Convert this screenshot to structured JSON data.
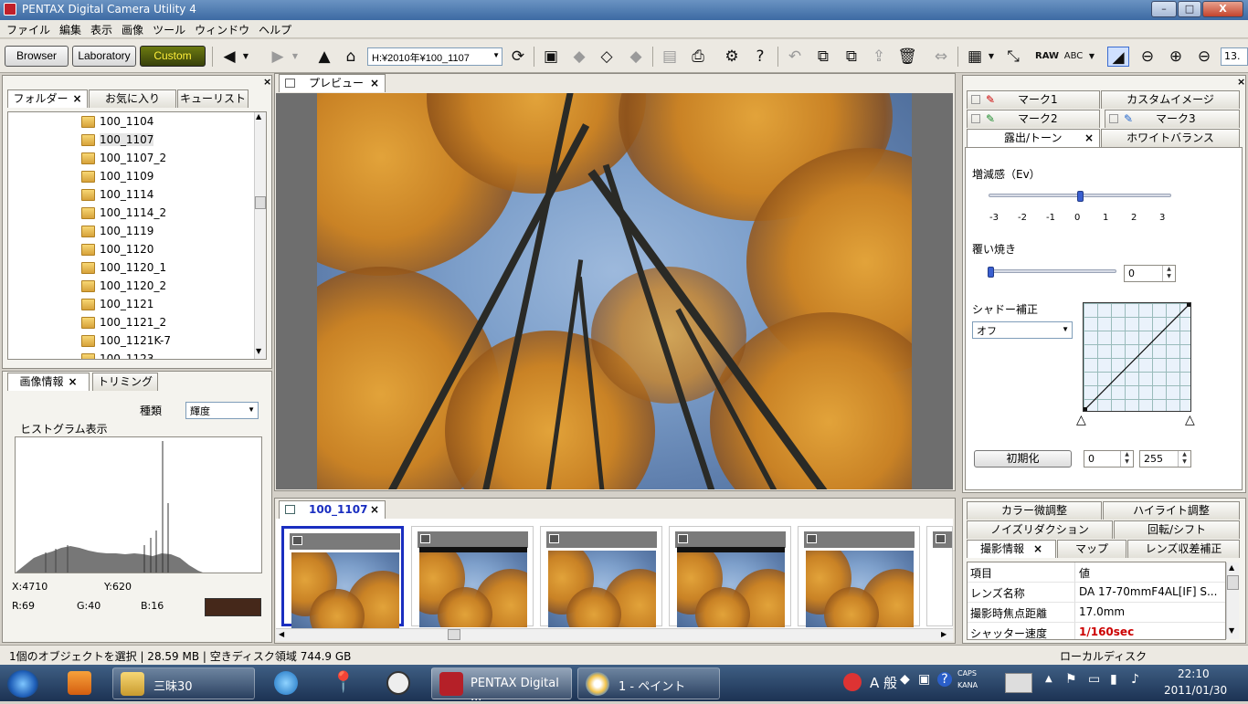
{
  "window": {
    "title": "PENTAX Digital Camera Utility 4",
    "min": "–",
    "max": "□",
    "close": "X"
  },
  "menu": [
    "ファイル",
    "編集",
    "表示",
    "画像",
    "ツール",
    "ウィンドウ",
    "ヘルプ"
  ],
  "toolbar": {
    "browser": "Browser",
    "laboratory": "Laboratory",
    "custom": "Custom",
    "path": "H:¥2010年¥100_1107",
    "zoom": "13."
  },
  "left": {
    "tabs": {
      "folder": "フォルダー",
      "favorites": "お気に入り",
      "curelist": "キューリスト"
    },
    "folders": [
      "100_1104",
      "100_1107",
      "100_1107_2",
      "100_1109",
      "100_1114",
      "100_1114_2",
      "100_1119",
      "100_1120",
      "100_1120_1",
      "100_1120_2",
      "100_1121",
      "100_1121_2",
      "100_1121K-7",
      "100_1123"
    ],
    "selected_folder": "100_1107",
    "info_tabs": {
      "image_info": "画像情報",
      "trimming": "トリミング"
    },
    "kind_label": "種類",
    "kind_value": "輝度",
    "histogram_label": "ヒストグラム表示",
    "x": "X:4710",
    "y": "Y:620",
    "r": "R:69",
    "g": "G:40",
    "b": "B:16",
    "swatch": "#45281a"
  },
  "preview": {
    "tab": "プレビュー",
    "close": "×"
  },
  "thumbs": {
    "tab": "100_1107",
    "close": "×"
  },
  "right": {
    "tabs": {
      "mark1": "マーク1",
      "custom_image": "カスタムイメージ",
      "mark2": "マーク2",
      "mark3": "マーク3",
      "exposure": "露出/トーン",
      "wb": "ホワイトバランス"
    },
    "ev_label": "増減感（Ev）",
    "ev_ticks": [
      "-3",
      "-2",
      "-1",
      "0",
      "1",
      "2",
      "3"
    ],
    "burn_label": "覆い焼き",
    "burn_value": "0",
    "shadow_label": "シャドー補正",
    "shadow_value": "オフ",
    "reset": "初期化",
    "lo": "0",
    "hi": "255",
    "bottom_tabs": {
      "color": "カラー微調整",
      "highlight": "ハイライト調整",
      "noise": "ノイズリダクション",
      "rotate": "回転/シフト",
      "shooting": "撮影情報",
      "map": "マップ",
      "lens": "レンズ収差補正"
    },
    "table_header": {
      "item": "項目",
      "value": "値"
    },
    "table_rows": [
      {
        "item": "レンズ名称",
        "value": "DA 17-70mmF4AL[IF] S..."
      },
      {
        "item": "撮影時焦点距離",
        "value": "17.0mm"
      },
      {
        "item": "シャッター速度",
        "value": "1/160sec"
      }
    ],
    "shutter_color": "#cc0000"
  },
  "status": {
    "left": "1個のオブジェクトを選択 | 28.59 MB | 空きディスク領域 744.9 GB",
    "right": "ローカルディスク"
  },
  "taskbar": {
    "folder_task": "三昧30",
    "pentax_task": "PENTAX Digital ...",
    "paint_task": "1 - ペイント",
    "ime": "A 般",
    "caps": "CAPS",
    "kana": "KANA",
    "time": "22:10",
    "date": "2011/01/30"
  }
}
